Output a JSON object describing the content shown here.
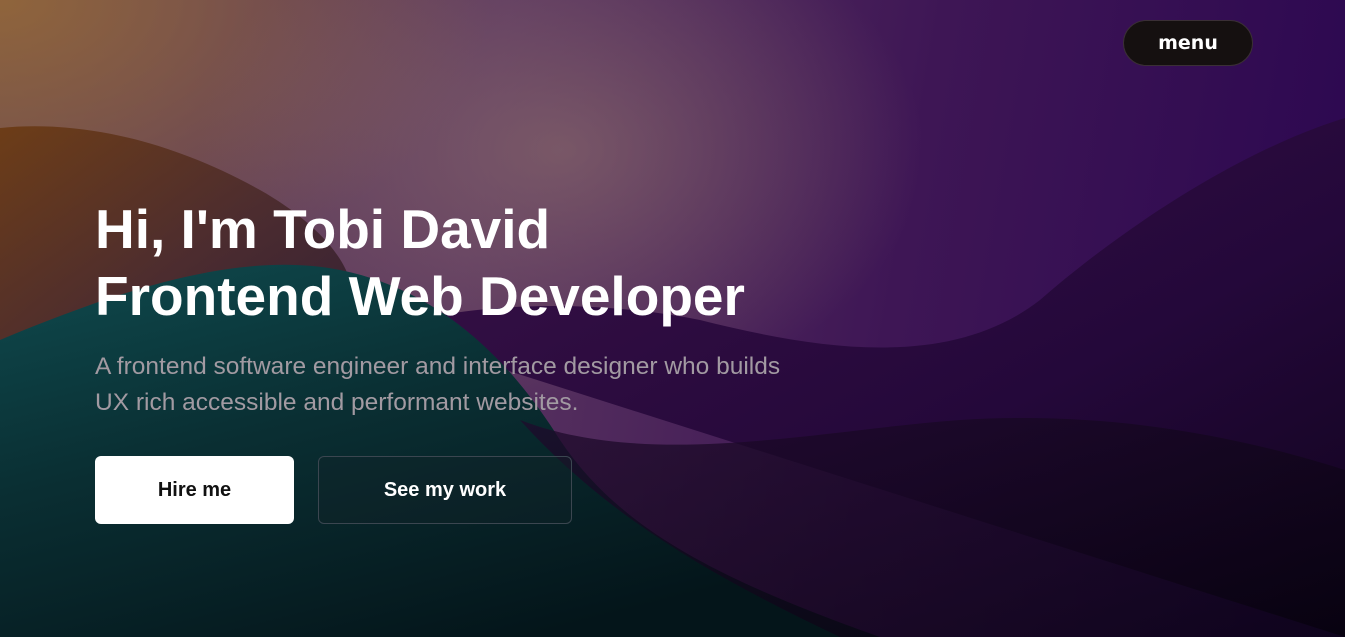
{
  "nav": {
    "menu_label": "menu"
  },
  "hero": {
    "headline_line1": "Hi, I'm Tobi David",
    "headline_line2": "Frontend Web Developer",
    "subtitle_line1": "A frontend software engineer and interface designer who builds",
    "subtitle_line2": "UX rich accessible and performant websites."
  },
  "actions": {
    "hire_label": "Hire me",
    "work_label": "See my work"
  },
  "colors": {
    "button_primary_bg": "#ffffff",
    "menu_bg": "#151010",
    "headline": "#ffffff",
    "subtitle": "#a29aa2"
  }
}
